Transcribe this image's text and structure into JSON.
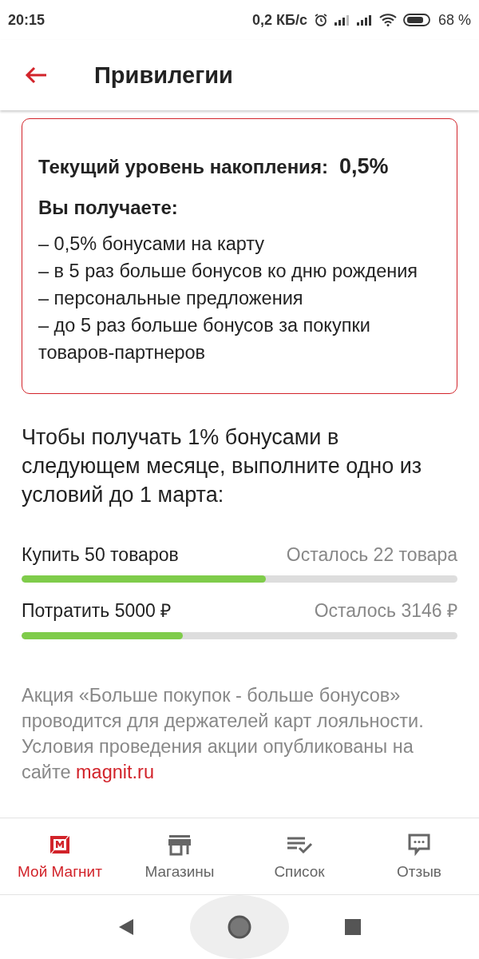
{
  "status_bar": {
    "time": "20:15",
    "speed": "0,2 КБ/с",
    "battery": "68 %"
  },
  "header": {
    "title": "Привилегии"
  },
  "level_card": {
    "label": "Текущий уровень накопления:",
    "value": "0,5%",
    "benefits_title": "Вы получаете:",
    "benefits": [
      "– 0,5% бонусами на карту",
      "– в 5 раз больше бонусов ко дню рождения",
      "– персональные предложения",
      "– до 5 раз больше бонусов за покупки товаров-партнеров"
    ]
  },
  "intro": "Чтобы получать 1% бонусами в следующем месяце, выполните одно из условий до 1 марта:",
  "conditions": [
    {
      "name": "Купить 50 товаров",
      "remaining": "Осталось 22 товара",
      "level": 0.56
    },
    {
      "name": "Потратить 5000 ₽",
      "remaining": "Осталось 3146 ₽",
      "level": 0.37
    }
  ],
  "disclaimer": {
    "text": "Акция «Больше покупок - больше бонусов» проводится для держателей карт лояльности. Условия проведения акции опубликованы на сайте",
    "link": "magnit.ru"
  },
  "bottom_nav": [
    {
      "kind": "logo",
      "label": "Мой Магнит",
      "selected": true
    },
    {
      "kind": "store",
      "label": "Магазины",
      "selected": false
    },
    {
      "kind": "list",
      "label": "Список",
      "selected": false
    },
    {
      "kind": "feedback",
      "label": "Отзыв",
      "selected": false
    }
  ]
}
